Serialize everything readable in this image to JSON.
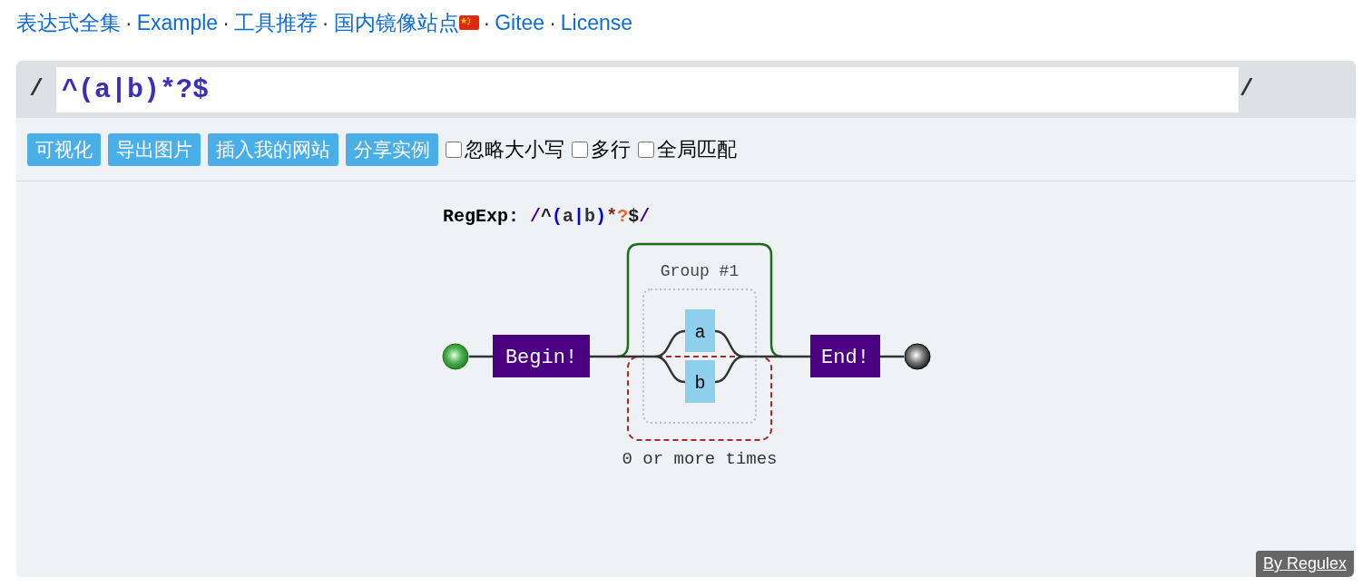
{
  "nav": [
    {
      "kind": "link",
      "text": "表达式全集"
    },
    {
      "kind": "separator",
      "text": "·"
    },
    {
      "kind": "link",
      "text": "Example"
    },
    {
      "kind": "separator",
      "text": "·"
    },
    {
      "kind": "link",
      "text": "工具推荐"
    },
    {
      "kind": "separator",
      "text": "·"
    },
    {
      "kind": "link",
      "text": "国内镜像站点"
    },
    {
      "kind": "flag"
    },
    {
      "kind": "separator",
      "text": "·"
    },
    {
      "kind": "link",
      "text": "Gitee"
    },
    {
      "kind": "separator",
      "text": "·"
    },
    {
      "kind": "link",
      "text": "License"
    }
  ],
  "regex": {
    "open": "/",
    "value": "^(a|b)*?$",
    "close": "/"
  },
  "buttons": [
    "可视化",
    "导出图片",
    "插入我的网站",
    "分享实例"
  ],
  "options": [
    {
      "label": "忽略大小写",
      "checked": false
    },
    {
      "label": "多行",
      "checked": false
    },
    {
      "label": "全局匹配",
      "checked": false
    }
  ],
  "diagram": {
    "title": "RegExp:",
    "tokens": [
      {
        "text": "/",
        "color": "#4b0082"
      },
      {
        "text": "^",
        "color": "#222222"
      },
      {
        "text": "(",
        "color": "#0000ee"
      },
      {
        "text": "a",
        "color": "#333333"
      },
      {
        "text": "|",
        "color": "#0000ee"
      },
      {
        "text": "b",
        "color": "#333333"
      },
      {
        "text": ")",
        "color": "#0000ee"
      },
      {
        "text": "*",
        "color": "#8b1a1a"
      },
      {
        "text": "?",
        "color": "#ee6633"
      },
      {
        "text": "$",
        "color": "#222222"
      },
      {
        "text": "/",
        "color": "#4b0082"
      }
    ],
    "begin": "Begin!",
    "end": "End!",
    "group_label": "Group #1",
    "alternatives": [
      "a",
      "b"
    ],
    "repeat_label": "0 or more times"
  },
  "credit": "By Regulex"
}
